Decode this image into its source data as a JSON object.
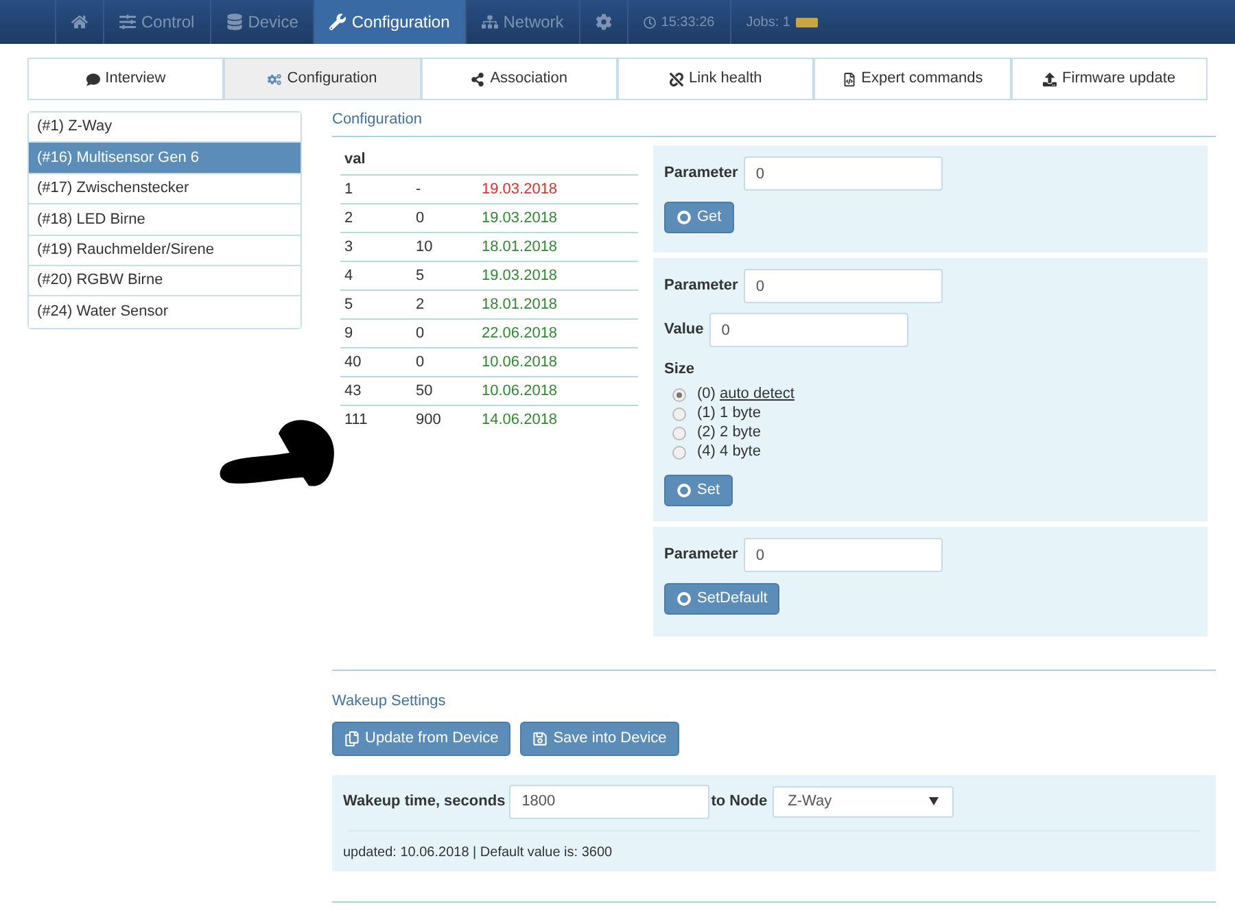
{
  "nav": [
    {
      "selected": false
    },
    {
      "label": "Control",
      "selected": false
    },
    {
      "label": "Device",
      "selected": false
    },
    {
      "label": "Configuration",
      "selected": true
    },
    {
      "label": "Network",
      "selected": false
    },
    {
      "selected": false
    },
    {
      "label": "15:33:26",
      "selected": false
    },
    {
      "label": "Jobs: 1",
      "selected": false
    }
  ],
  "tabs": [
    {
      "label": "Interview",
      "selected": false
    },
    {
      "label": "Configuration",
      "selected": true
    },
    {
      "label": "Association",
      "selected": false
    },
    {
      "label": "Link health",
      "selected": false
    },
    {
      "label": "Expert commands",
      "selected": false
    },
    {
      "label": "Firmware update",
      "selected": false
    }
  ],
  "devices": [
    {
      "label": "(#1) Z-Way",
      "selected": false
    },
    {
      "label": "(#16) Multisensor Gen 6",
      "selected": true
    },
    {
      "label": "(#17) Zwischenstecker",
      "selected": false
    },
    {
      "label": "(#18) LED Birne",
      "selected": false
    },
    {
      "label": "(#19) Rauchmelder/Sirene",
      "selected": false
    },
    {
      "label": "(#20) RGBW Birne",
      "selected": false
    },
    {
      "label": "(#24) Water Sensor",
      "selected": false
    }
  ],
  "configuration": {
    "title": "Configuration",
    "table": {
      "columns": [
        "val"
      ],
      "rows": [
        {
          "param": "1",
          "value": "-",
          "date": "19.03.2018",
          "color": "#e0302a"
        },
        {
          "param": "2",
          "value": "0",
          "date": "19.03.2018",
          "color": "#2e8b2e"
        },
        {
          "param": "3",
          "value": "10",
          "date": "18.01.2018",
          "color": "#2e8b2e"
        },
        {
          "param": "4",
          "value": "5",
          "date": "19.03.2018",
          "color": "#2e8b2e"
        },
        {
          "param": "5",
          "value": "2",
          "date": "18.01.2018",
          "color": "#2e8b2e"
        },
        {
          "param": "9",
          "value": "0",
          "date": "22.06.2018",
          "color": "#2e8b2e"
        },
        {
          "param": "40",
          "value": "0",
          "date": "10.06.2018",
          "color": "#2e8b2e"
        },
        {
          "param": "43",
          "value": "50",
          "date": "10.06.2018",
          "color": "#2e8b2e"
        },
        {
          "param": "111",
          "value": "900",
          "date": "14.06.2018",
          "color": "#2e8b2e"
        }
      ]
    },
    "get": {
      "parameter_label": "Parameter",
      "parameter": "0",
      "button": "Get"
    },
    "set": {
      "parameter_label": "Parameter",
      "parameter": "0",
      "value_label": "Value",
      "value": "0",
      "size_label": "Size",
      "sizes": [
        {
          "prefix": "(0)",
          "label": "auto detect",
          "underlined": true,
          "selected": true
        },
        {
          "prefix": "(1)",
          "label": "1 byte",
          "underlined": false,
          "selected": false
        },
        {
          "prefix": "(2)",
          "label": "2 byte",
          "underlined": false,
          "selected": false
        },
        {
          "prefix": "(4)",
          "label": "4 byte",
          "underlined": false,
          "selected": false
        }
      ],
      "button": "Set"
    },
    "set_default": {
      "parameter_label": "Parameter",
      "parameter": "0",
      "button": "SetDefault"
    }
  },
  "wakeup": {
    "title": "Wakeup Settings",
    "buttons": [
      "Update from Device",
      "Save into Device"
    ],
    "time_label": "Wakeup time, seconds",
    "time": "1800",
    "node_label": "to Node",
    "node": "Z-Way",
    "status": "updated: 10.06.2018 | Default value is: 3600"
  }
}
